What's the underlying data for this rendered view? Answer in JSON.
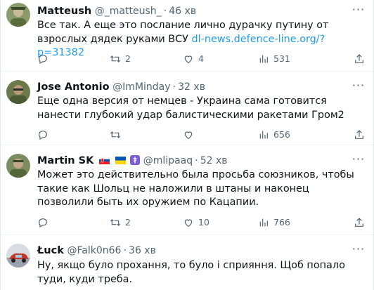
{
  "tweets": [
    {
      "name": "Matteush",
      "handle": "@_matteush_",
      "time": "46 хв",
      "text_plain": "Все так. А еще это послание лично дурачку путину от взрослых дядек руками ВСУ ",
      "link": "dl-news.defence-line.org/?p=31382",
      "replies": "",
      "retweets": "2",
      "likes": "4",
      "views": "531"
    },
    {
      "name": "Jose Antonio",
      "handle": "@ImMinday",
      "time": "32 хв",
      "text_plain": "Еще одна версия от немцев - Украина сама готовится нанести глубокий удар балистическими ракетами Гром2",
      "replies": "",
      "retweets": "",
      "likes": "",
      "views": "656"
    },
    {
      "name": "Martin SK",
      "handle": "@mlipaaq",
      "time": "52 хв",
      "text_plain": "Может это действительно была просьба союзников, чтобы такие как Шольц не наложили в штаны и наконец позволили быть их оружием по Кацапии.",
      "replies": "",
      "retweets": "2",
      "likes": "10",
      "views": "766"
    },
    {
      "name": "Łuck",
      "handle": "@Falk0n66",
      "time": "36 хв",
      "text_plain": "Ну, якщо було прохання, то було і сприяння. Щоб попало туди, куди треба."
    }
  ],
  "colors": {
    "text": "#0f1419",
    "secondary": "#536471",
    "link": "#1d9bf0",
    "divider": "#eff3f4"
  },
  "icons": [
    "reply-icon",
    "retweet-icon",
    "like-icon",
    "views-icon",
    "share-icon",
    "more-icon"
  ]
}
